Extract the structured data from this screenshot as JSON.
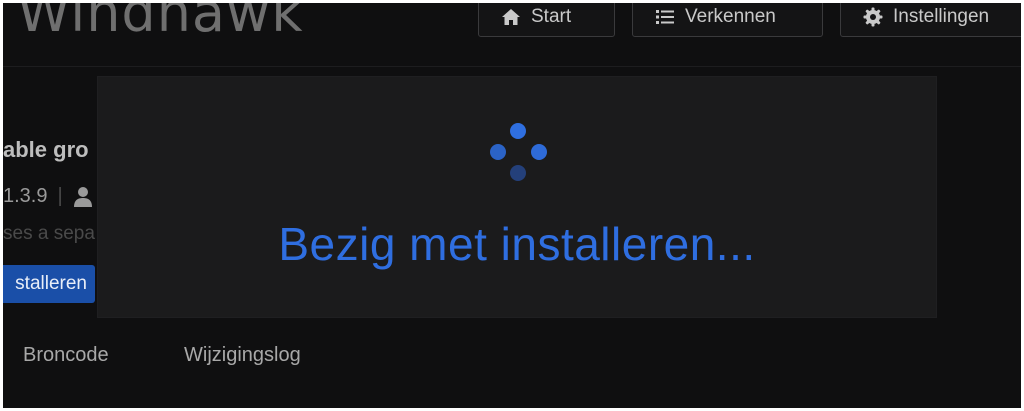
{
  "app": {
    "title": "Windhawk"
  },
  "nav": {
    "start_label": "Start",
    "explore_label": "Verkennen",
    "settings_label": "Instellingen"
  },
  "mod": {
    "title_fragment": "able gro",
    "version": "1.3.9",
    "description_fragment": "ses a sepa",
    "install_label": "stalleren"
  },
  "tabs": {
    "source_label": "Broncode",
    "changelog_label": "Wijzigingslog"
  },
  "modal": {
    "status_text": "Bezig met installeren..."
  },
  "colors": {
    "background": "#0f0f10",
    "modal_background": "#1b1b1c",
    "accent": "#2f6ee0",
    "install_button": "#1a4fa8"
  },
  "icons": {
    "start": "home-icon",
    "explore": "list-icon",
    "settings": "gear-icon",
    "author": "user-icon"
  }
}
